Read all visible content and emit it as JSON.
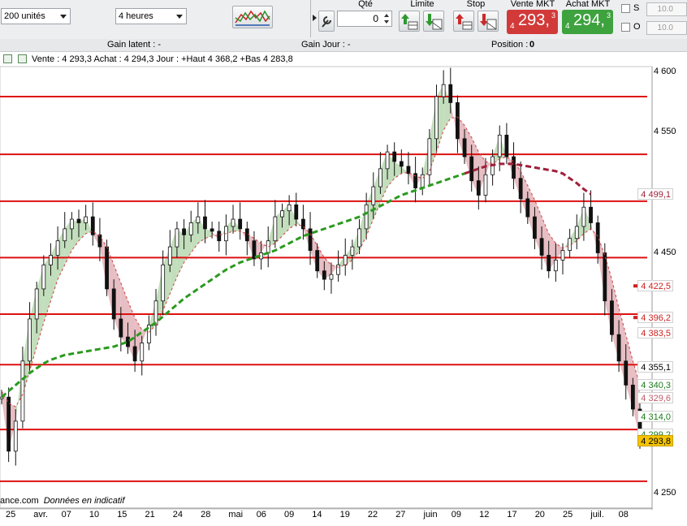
{
  "toolbar": {
    "units_select": "200 unités",
    "period_select": "4 heures",
    "qty_label": "Qté",
    "qty_value": "0",
    "limit_label": "Limite",
    "stop_label": "Stop",
    "sell_mkt_label": "Vente MKT",
    "buy_mkt_label": "Achat MKT",
    "sell_small": "4",
    "sell_big": "293,",
    "sell_sup": "3",
    "buy_small": "4",
    "buy_big": "294,",
    "buy_sup": "3",
    "s_label": "S",
    "o_label": "O",
    "s_value": "10.0",
    "o_value": "10.0",
    "sell_color": "#d23a3a",
    "buy_color": "#3ea23e"
  },
  "gainbar": {
    "latent": "Gain latent : -",
    "jour": "Gain Jour : -",
    "position_prefix": "Position :",
    "position_value": "0"
  },
  "infobar": {
    "text": "Vente : 4 293,3 Achat : 4 294,3 Jour : +Haut 4 368,2 +Bas 4 283,8"
  },
  "footer": {
    "source": "ance.com",
    "note": "Données en indicatif"
  },
  "chart_data": {
    "type": "line",
    "ylim": [
      4243,
      4605
    ],
    "x_tick_labels": [
      "25",
      "avr.",
      "07",
      "10",
      "15",
      "21",
      "24",
      "28",
      "mai",
      "06",
      "09",
      "14",
      "19",
      "22",
      "27",
      "juin",
      "09",
      "12",
      "17",
      "20",
      "25",
      "juil.",
      "08"
    ],
    "y_tick_labels": [
      "4 600",
      "4 550",
      "4 499,1",
      "4 450",
      "4 422,5",
      "4 396,2",
      "4 383,5",
      "4 355,1",
      "4 340,3",
      "4 329,6",
      "4 314,0",
      "4 299,2",
      "4 293,8",
      "4 250"
    ],
    "right_labels": [
      {
        "text": "4 499,1",
        "value": 4499.1,
        "color": "#a0203a",
        "bg": "#ffffff"
      },
      {
        "text": "4 422,5",
        "value": 4422.5,
        "color": "#cc2222",
        "bg": "#ffffff"
      },
      {
        "text": "4 396,2",
        "value": 4396.2,
        "color": "#cc2222",
        "bg": "#ffffff"
      },
      {
        "text": "4 383,5",
        "value": 4383.5,
        "color": "#cc2222",
        "bg": "#ffffff"
      },
      {
        "text": "4 355,1",
        "value": 4355.1,
        "color": "#000000",
        "bg": "#ffffff"
      },
      {
        "text": "4 340,3",
        "value": 4340.3,
        "color": "#1b7a1b",
        "bg": "#ffffff"
      },
      {
        "text": "4 329,6",
        "value": 4329.6,
        "color": "#c05a6a",
        "bg": "#ffffff"
      },
      {
        "text": "4 314,0",
        "value": 4314.0,
        "color": "#1b7a1b",
        "bg": "#ffffff"
      },
      {
        "text": "4 299,2",
        "value": 4299.2,
        "color": "#1b7a1b",
        "bg": "#ffffff"
      },
      {
        "text": "4 293,8",
        "value": 4293.8,
        "color": "#000000",
        "bg": "#f5c400"
      }
    ],
    "horizontal_levels": [
      4580,
      4532,
      4493,
      4446,
      4399,
      4357,
      4303,
      4260
    ],
    "price_series": [
      4330,
      4285,
      4310,
      4360,
      4395,
      4420,
      4440,
      4448,
      4460,
      4470,
      4478,
      4475,
      4480,
      4465,
      4455,
      4420,
      4395,
      4380,
      4372,
      4360,
      4375,
      4390,
      4410,
      4440,
      4455,
      4470,
      4465,
      4475,
      4480,
      4470,
      4468,
      4460,
      4472,
      4478,
      4470,
      4460,
      4445,
      4450,
      4460,
      4480,
      4485,
      4490,
      4478,
      4470,
      4452,
      4435,
      4428,
      4432,
      4440,
      4448,
      4455,
      4470,
      4490,
      4505,
      4520,
      4534,
      4526,
      4522,
      4516,
      4504,
      4515,
      4545,
      4580,
      4590,
      4575,
      4545,
      4530,
      4510,
      4498,
      4515,
      4530,
      4548,
      4530,
      4512,
      4495,
      4480,
      4462,
      4448,
      4435,
      4444,
      4452,
      4462,
      4472,
      4488,
      4475,
      4450,
      4410,
      4382,
      4360,
      4340,
      4320,
      4296
    ],
    "fast_ma": [
      4335,
      4325,
      4322,
      4332,
      4352,
      4372,
      4392,
      4410,
      4428,
      4440,
      4452,
      4460,
      4466,
      4468,
      4464,
      4455,
      4440,
      4425,
      4410,
      4396,
      4386,
      4384,
      4390,
      4402,
      4416,
      4430,
      4442,
      4450,
      4458,
      4462,
      4464,
      4465,
      4466,
      4468,
      4468,
      4466,
      4462,
      4458,
      4455,
      4458,
      4464,
      4470,
      4474,
      4472,
      4466,
      4456,
      4446,
      4440,
      4438,
      4440,
      4444,
      4452,
      4464,
      4478,
      4492,
      4505,
      4512,
      4516,
      4517,
      4514,
      4512,
      4518,
      4534,
      4552,
      4562,
      4563,
      4556,
      4546,
      4534,
      4526,
      4524,
      4528,
      4530,
      4526,
      4518,
      4506,
      4494,
      4480,
      4466,
      4458,
      4454,
      4456,
      4460,
      4466,
      4470,
      4464,
      4448,
      4428,
      4404,
      4382,
      4360,
      4340
    ],
    "slow_ma": [
      4330,
      4335,
      4340,
      4345,
      4350,
      4354,
      4358,
      4361,
      4363,
      4365,
      4366,
      4367,
      4368,
      4369,
      4370,
      4371,
      4372,
      4374,
      4376,
      4380,
      4384,
      4388,
      4392,
      4397,
      4402,
      4407,
      4412,
      4416,
      4420,
      4424,
      4428,
      4432,
      4436,
      4439,
      4442,
      4444,
      4446,
      4448,
      4450,
      4452,
      4455,
      4458,
      4461,
      4464,
      4466,
      4468,
      4470,
      4472,
      4474,
      4476,
      4478,
      4480,
      4483,
      4486,
      4489,
      4492,
      4495,
      4498,
      4500,
      4502,
      4504,
      4506,
      4508,
      4510,
      4512,
      4514,
      4516,
      4518,
      4520,
      4522,
      4523,
      4524,
      4524,
      4524,
      4523,
      4522,
      4521,
      4520,
      4519,
      4518,
      4516,
      4512,
      4508,
      4503,
      4499
    ]
  }
}
